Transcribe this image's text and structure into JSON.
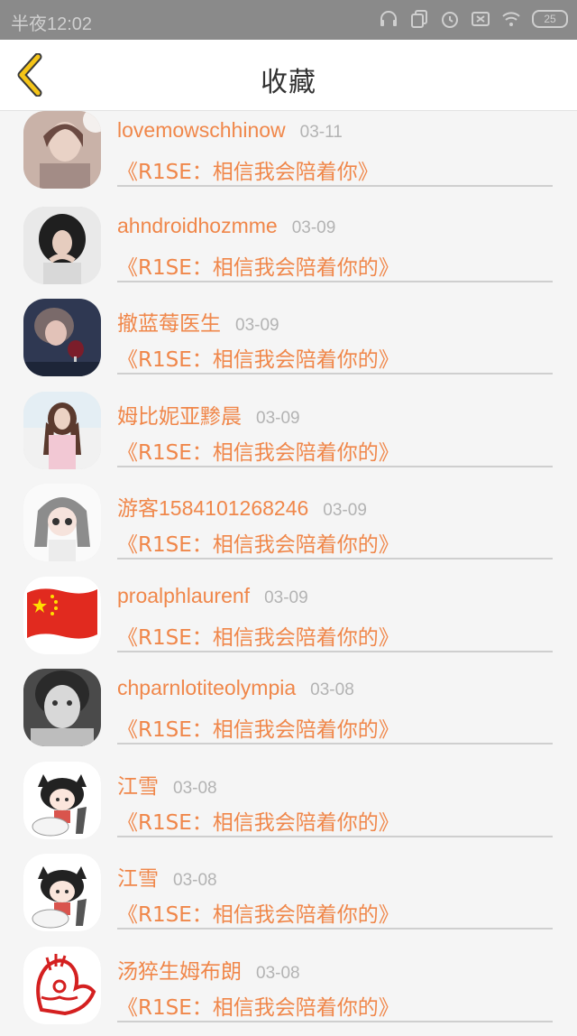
{
  "status_bar": {
    "time": "半夜12:02",
    "battery": "25"
  },
  "nav": {
    "title": "收藏"
  },
  "favorites": [
    {
      "name": "lovemowschhinow",
      "date": "03-11",
      "title": "《R1SE：相信我会陪着你》",
      "avatar": "avatar-photo-woman"
    },
    {
      "name": "ahndroidhozmme",
      "date": "03-09",
      "title": "《R1SE：相信我会陪着你的》",
      "avatar": "avatar-photo-curly-hair"
    },
    {
      "name": "撤蓝莓医生",
      "date": "03-09",
      "title": "《R1SE：相信我会陪着你的》",
      "avatar": "avatar-photo-wine"
    },
    {
      "name": "姆比妮亚黪晨",
      "date": "03-09",
      "title": "《R1SE：相信我会陪着你的》",
      "avatar": "avatar-photo-girl"
    },
    {
      "name": "游客1584101268246",
      "date": "03-09",
      "title": "《R1SE：相信我会陪着你的》",
      "avatar": "avatar-anime-girl"
    },
    {
      "name": "proalphlaurenf",
      "date": "03-09",
      "title": "《R1SE：相信我会陪着你的》",
      "avatar": "avatar-china-flag"
    },
    {
      "name": "chparnlotiteolympia",
      "date": "03-08",
      "title": "《R1SE：相信我会陪着你的》",
      "avatar": "avatar-photo-bw-child"
    },
    {
      "name": "江雪",
      "date": "03-08",
      "title": "《R1SE：相信我会陪着你的》",
      "avatar": "avatar-cartoon-cat-girl"
    },
    {
      "name": "江雪",
      "date": "03-08",
      "title": "《R1SE：相信我会陪着你的》",
      "avatar": "avatar-cartoon-cat-girl"
    },
    {
      "name": "汤猝生姆布朗",
      "date": "03-08",
      "title": "《R1SE：相信我会陪着你的》",
      "avatar": "avatar-papercut-rooster"
    }
  ],
  "colors": {
    "accent": "#f0874a",
    "back_arrow": "#f5c518",
    "date": "#b3b3b3"
  }
}
